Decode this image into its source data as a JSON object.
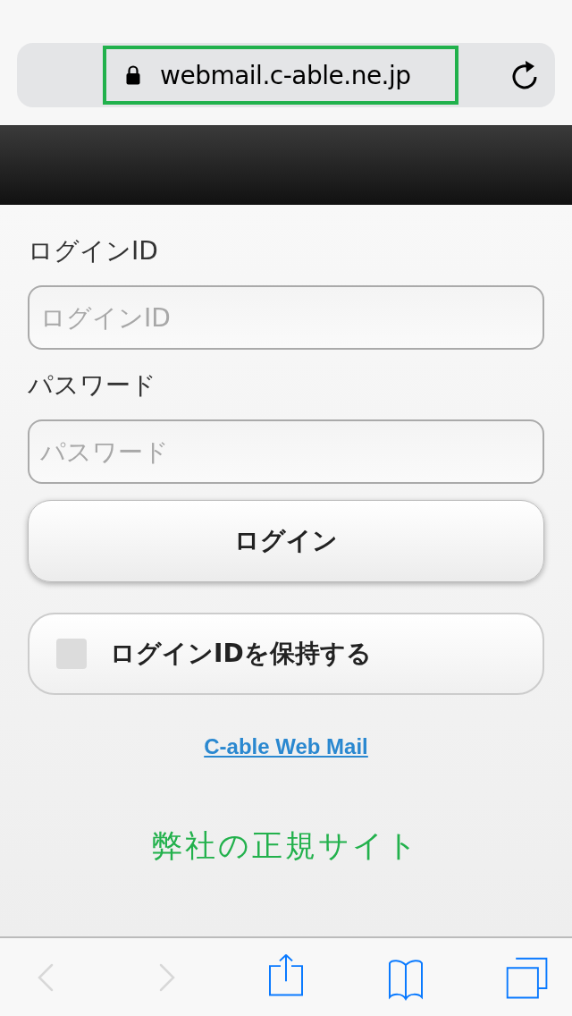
{
  "browser": {
    "url": "webmail.c-able.ne.jp",
    "url_highlighted": true
  },
  "form": {
    "fields": [
      {
        "label": "ログインID",
        "placeholder": "ログインID"
      },
      {
        "label": "パスワード",
        "placeholder": "パスワード"
      }
    ],
    "login_button": "ログイン",
    "remember": {
      "label": "ログインIDを保持する",
      "checked": false
    },
    "link": "C-able Web Mail",
    "notice": "弊社の正規サイト"
  },
  "toolbar": [
    {
      "kind": "back",
      "disabled": true
    },
    {
      "kind": "forward",
      "disabled": true
    },
    {
      "kind": "share",
      "disabled": false
    },
    {
      "kind": "bookmarks",
      "disabled": false
    },
    {
      "kind": "tabs",
      "disabled": false
    }
  ]
}
